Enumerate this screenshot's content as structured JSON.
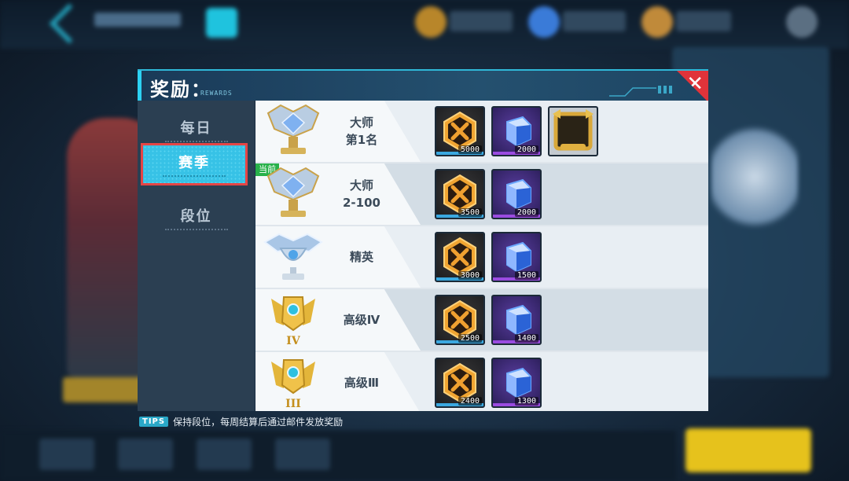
{
  "dialog": {
    "title": "奖励：",
    "subtitle": "REWARDS",
    "close_icon": "close-icon",
    "close_glyph": "✕"
  },
  "sidebar": {
    "tabs": [
      {
        "label": "每日",
        "active": false
      },
      {
        "label": "赛季",
        "active": true
      },
      {
        "label": "段位",
        "active": false
      }
    ]
  },
  "current_tag": "当前",
  "rewards": [
    {
      "rank": "大师",
      "sub": "第1名",
      "trophy_icon": "master-trophy-icon",
      "items": [
        {
          "type": "coin",
          "icon": "sword-coin-icon",
          "qty": "5000"
        },
        {
          "type": "cube",
          "icon": "cube-icon",
          "qty": "2000"
        },
        {
          "type": "frame",
          "icon": "gold-avatar-frame-icon",
          "qty": ""
        }
      ]
    },
    {
      "rank": "大师",
      "sub": "2-100",
      "trophy_icon": "master-trophy-icon",
      "current": true,
      "items": [
        {
          "type": "coin",
          "icon": "sword-coin-icon",
          "qty": "3500"
        },
        {
          "type": "cube",
          "icon": "cube-icon",
          "qty": "2000"
        }
      ]
    },
    {
      "rank": "精英",
      "sub": "",
      "trophy_icon": "elite-trophy-icon",
      "items": [
        {
          "type": "coin",
          "icon": "sword-coin-icon",
          "qty": "3000"
        },
        {
          "type": "cube",
          "icon": "cube-icon",
          "qty": "1500"
        }
      ]
    },
    {
      "rank": "高级Ⅳ",
      "sub": "",
      "trophy_icon": "advanced-iv-trophy-icon",
      "items": [
        {
          "type": "coin",
          "icon": "sword-coin-icon",
          "qty": "2500"
        },
        {
          "type": "cube",
          "icon": "cube-icon",
          "qty": "1400"
        }
      ]
    },
    {
      "rank": "高级Ⅲ",
      "sub": "",
      "trophy_icon": "advanced-iii-trophy-icon",
      "items": [
        {
          "type": "coin",
          "icon": "sword-coin-icon",
          "qty": "2400"
        },
        {
          "type": "cube",
          "icon": "cube-icon",
          "qty": "1300"
        }
      ]
    }
  ],
  "tips": {
    "badge": "TIPS",
    "text": "保持段位，每周结算后通过邮件发放奖励"
  },
  "colors": {
    "accent": "#37c2e6",
    "close": "#e0333a",
    "current": "#28b14a"
  }
}
